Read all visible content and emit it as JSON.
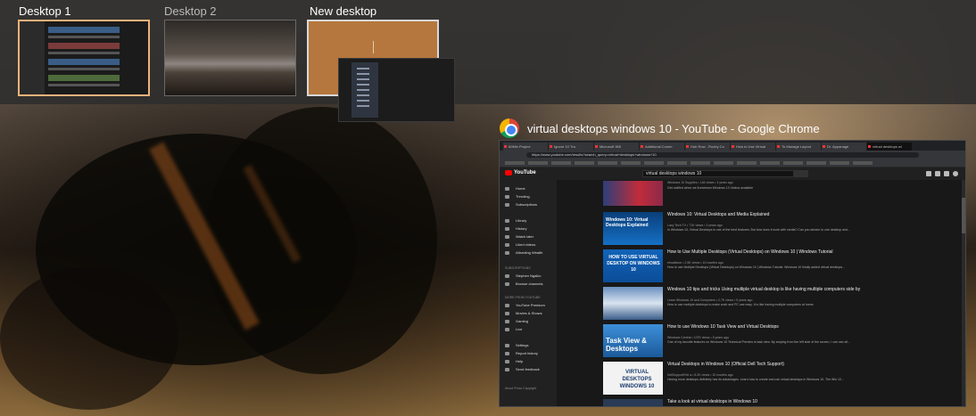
{
  "desktops": [
    {
      "label": "Desktop 1",
      "state": "active"
    },
    {
      "label": "Desktop 2",
      "state": "inactive"
    },
    {
      "label": "New desktop",
      "state": "hover"
    }
  ],
  "window": {
    "title": "virtual desktops windows 10 - YouTube - Google Chrome",
    "icon": "chrome-icon"
  },
  "browser": {
    "tabs": [
      "60Min Project",
      "Ignore 10 Tra",
      "Microsoft 365",
      "Additional Comm",
      "Hub Row - Rooby Co",
      "How to Use Virtual",
      "To Manage Layout",
      "Dr. Appanage",
      "virtual desktops wi"
    ],
    "url": "https://www.youtube.com/results?search_query=virtual+desktops+windows+10",
    "search_value": "virtual desktops windows 10",
    "logo": "YouTube"
  },
  "sidebar": {
    "items_top": [
      "Home",
      "Trending",
      "Subscriptions"
    ],
    "items_library": [
      "Library",
      "History",
      "Watch later",
      "Liked videos",
      "Attracting Wealth"
    ],
    "subs_header": "SUBSCRIPTIONS",
    "subs": [
      "Stephen Ngaiko",
      "Browse channels"
    ],
    "more_header": "MORE FROM YOUTUBE",
    "more": [
      "YouTube Premium",
      "Movies & Shows",
      "Gaming",
      "Live"
    ],
    "bottom": [
      "Settings",
      "Report history",
      "Help",
      "Send feedback"
    ],
    "footer": "About  Press  Copyright"
  },
  "results": [
    {
      "title": "",
      "meta": "Windows 10 Supplies • 146 views • 3 years ago",
      "desc": "Get notified when we livestream Windows 10 Videos available"
    },
    {
      "title": "Windows 10: Virtual Desktops and Media Explained",
      "meta": "Lazy Tech TV • 71K views • 3 years ago",
      "desc": "In Windows 10, Virtual Desktops is one of the best features. But how does it work with media? Can you stream to one desktop and...",
      "thumb_text": "Windows 10: Virtual Desktops Explained"
    },
    {
      "title": "How to Use Multiple Desktops (Virtual Desktops) on Windows 10 | Windows Tutorial",
      "meta": "ehowttutor • 2.5K views • 10 months ago",
      "desc": "How to use Multiple Desktops (Virtual Desktops) on Windows 10 | Windows Tutorial. Windows 10 finally added virtual desktops...",
      "thumb_text": "HOW TO USE VIRTUAL DESKTOP ON WINDOWS 10"
    },
    {
      "title": "Windows 10 tips and tricks Using multiple virtual desktop is like having multiple computers side by",
      "meta": "Learn Windows 10 and Computers • 2.7K views • 5 years ago",
      "desc": "How to use multiple desktops to make work and PC use easy. It is like having multiple computers at home."
    },
    {
      "title": "How to use Windows 10 Task View and Virtual Desktops",
      "meta": "Windows Central • 107K views • 5 years ago",
      "desc": "One of my favorite features on Windows 10 Technical Preview is task view. By swiping from the left side of the screen, I can see all...",
      "thumb_text": "Task View & Desktops"
    },
    {
      "title": "Virtual Desktops in Windows 10 (Official Dell Tech Support)",
      "meta": "DellSupportFelt ● • 8.2K views • 10 months ago",
      "desc": "Having more desktops definitely has its advantages. Learn how to create and use virtual desktops in Windows 10. The Win 10...",
      "thumb_text": "VIRTUAL DESKTOPS WINDOWS 10"
    },
    {
      "title": "Take a look at virtual desktops in Windows 10",
      "meta": "",
      "desc": ""
    }
  ],
  "colors": {
    "active_border": "#f0b27a",
    "bar_bg": "#2d2d2d",
    "yt_bg": "#181818"
  }
}
